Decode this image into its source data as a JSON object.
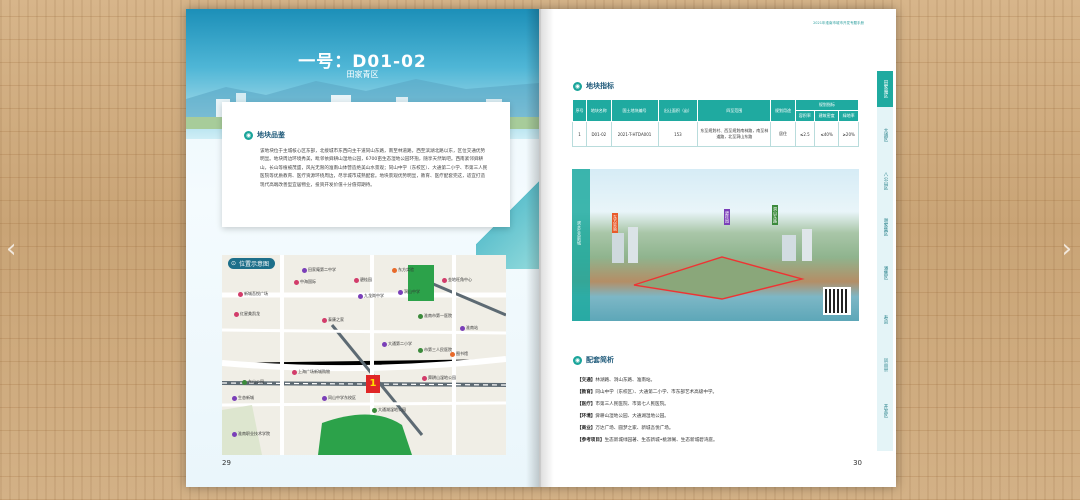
{
  "viewer": {
    "prev_icon": "chevron-left-icon",
    "next_icon": "chevron-right-icon",
    "prev": "‹",
    "next": "›"
  },
  "left_page": {
    "title": "一号：D01-02",
    "subtitle": "田家青区",
    "overview": {
      "heading": "地块品鉴",
      "body": "该地块位于主城核心区东部，北接城市东西向主干道同山东路，南至林道路，西至滨湖北路以东，区位交通优势明显。地块周边环境秀美，毗邻依舜耕山湿地公园，6700亩生态湿地公园环抱，随享天然氧吧。西南紧邻舜耕山，长山等植被茂盛，风光无限的淮南山体营造绝美山水景观；同山中学（东校区）、大通第二小学、市第三人民医院等优质教育、医疗资源环绕周边，尽享城市成熟配套。地块景观优势明显，教育、医疗配套完这，适宜打造现代高端改善型宜居物业，投资开发价值十分值得期待。"
    },
    "map": {
      "heading": "位置示意图",
      "marker": "1",
      "pins": [
        "田家庵第二中学",
        "东方实验",
        "金地旺角中心",
        "中海国际",
        "碧桂园",
        "新城吾悦广场",
        "九龙岗中学",
        "洞山中学",
        "淮南市第一医院",
        "红星美凯龙",
        "泰康之家",
        "淮南站",
        "市第三人民医院",
        "大通第二小学",
        "图书馆",
        "上海广场新城购物",
        "东山公园",
        "舜耕山湿地公园",
        "同山中学东校区",
        "大通湖湿地公园",
        "淮南职业技术学院",
        "生态新城"
      ]
    },
    "page_number": "29"
  },
  "right_page": {
    "header": "2021年淮南市城市开发专题手册",
    "indicators": {
      "heading": "地块指标",
      "columns": [
        "序号",
        "地块名称",
        "国土地块编号",
        "出让面积（亩）",
        "四至范围",
        "规划用途",
        "容积率",
        "建筑密度",
        "绿地率"
      ],
      "group_header": "规划指标",
      "rows": [
        [
          "1",
          "D01-02",
          "2021-T-HTDA001",
          "153",
          "东至规划村、西至规划南林路，南至林道路，北至洞山东路",
          "居住",
          "≤2.5",
          "≤40%",
          "≥20%"
        ]
      ]
    },
    "photo_labels": [
      "滨水生态新城",
      "东方实验",
      "碧桂园",
      "洞山东路"
    ],
    "supporting": {
      "heading": "配套简析",
      "items": [
        {
          "k": "【交通】",
          "v": "林湖路、洞山东路、淮南站。"
        },
        {
          "k": "【教育】",
          "v": "同山中学（东校区）、大通第二小学、市东部艺术高级中学。"
        },
        {
          "k": "【医疗】",
          "v": "市第三人民医院、市第七人民医院。"
        },
        {
          "k": "【环境】",
          "v": "舜耕山湿地公园、大通湖湿地公园。"
        },
        {
          "k": "【商业】",
          "v": "万达广场、圆梦之家、新城吾悦广场。"
        },
        {
          "k": "【参考项目】",
          "v": "生态新城绿园著、生态新城•桃源阁、生态新城碧湾庭。"
        }
      ]
    },
    "tabs": [
      "田家庵区",
      "大通区",
      "八公山区",
      "谢家集区",
      "潘集区",
      "寿县",
      "凤台县",
      "开发区"
    ],
    "active_tab": 0,
    "page_number": "30",
    "colors": {
      "accent": "#1faaa0",
      "marker": "#e02626"
    }
  }
}
